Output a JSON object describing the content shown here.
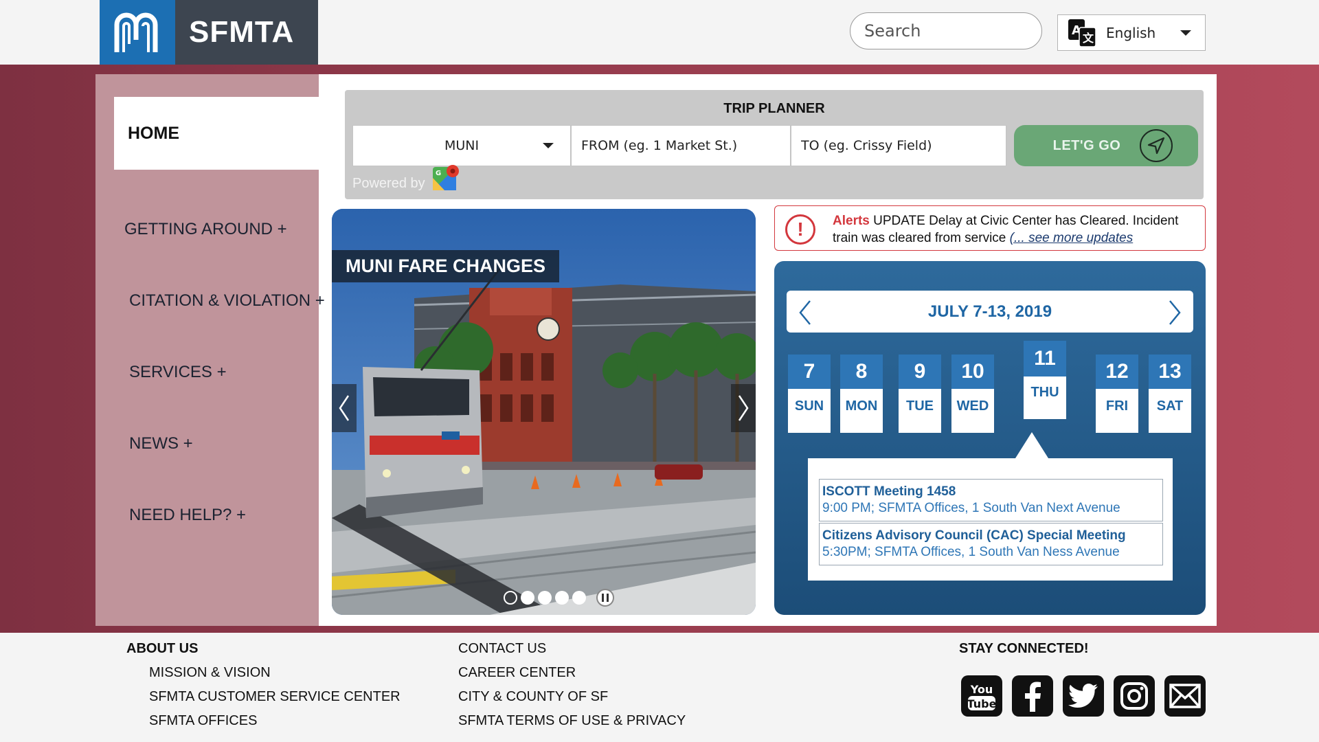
{
  "header": {
    "brand": "SFMTA",
    "search": {
      "placeholder": "Search",
      "icon": "search-icon"
    },
    "language": {
      "label": "English",
      "icon": "translate-icon"
    }
  },
  "nav": {
    "home": "HOME",
    "items": [
      "GETTING AROUND +",
      "CITATION & VIOLATION +",
      "SERVICES +",
      "NEWS +",
      "NEED HELP? +"
    ]
  },
  "trip_planner": {
    "title": "TRIP PLANNER",
    "mode": "MUNI",
    "from_placeholder": "FROM (eg. 1 Market St.)",
    "to_placeholder": "TO (eg. Crissy Field)",
    "go_label": "LET'G GO",
    "powered_by": "Powered by"
  },
  "slideshow": {
    "title": "MUNI FARE CHANGES",
    "slide_count": 5,
    "active_slide": 1
  },
  "alert": {
    "label": "Alerts",
    "message": "UPDATE Delay at Civic Center has Cleared. Incident train was cleared from service",
    "link": "(... see more updates"
  },
  "calendar": {
    "week_label": "JULY 7-13, 2019",
    "days": [
      {
        "num": "7",
        "name": "SUN"
      },
      {
        "num": "8",
        "name": "MON"
      },
      {
        "num": "9",
        "name": "TUE"
      },
      {
        "num": "10",
        "name": "WED"
      },
      {
        "num": "11",
        "name": "THU",
        "selected": true
      },
      {
        "num": "12",
        "name": "FRI"
      },
      {
        "num": "13",
        "name": "SAT"
      }
    ],
    "events": [
      {
        "title": "ISCOTT Meeting 1458",
        "details": "9:00 PM; SFMTA Offices, 1 South Van Next Avenue"
      },
      {
        "title": "Citizens Advisory Council (CAC) Special Meeting",
        "details": "5:30PM; SFMTA Offices, 1 South Van Ness Avenue"
      }
    ]
  },
  "footer": {
    "about_heading": "ABOUT US",
    "about_links": [
      "MISSION & VISION",
      "SFMTA CUSTOMER SERVICE CENTER",
      "SFMTA OFFICES"
    ],
    "links": [
      "CONTACT US",
      "CAREER CENTER",
      "CITY & COUNTY OF SF",
      "SFMTA TERMS OF USE & PRIVACY"
    ],
    "social_heading": "STAY CONNECTED!",
    "social": [
      {
        "name": "youtube-icon",
        "label": "You Tube"
      },
      {
        "name": "facebook-icon"
      },
      {
        "name": "twitter-icon"
      },
      {
        "name": "instagram-icon"
      },
      {
        "name": "email-icon"
      }
    ]
  },
  "colors": {
    "brand_blue": "#1c6fb3",
    "brand_dark": "#3d4550",
    "band_left": "#7e3041",
    "band_right": "#b34a5c",
    "go_green": "#6aa776",
    "alert_red": "#d3373d",
    "calendar_blue": "#2e76b6"
  }
}
